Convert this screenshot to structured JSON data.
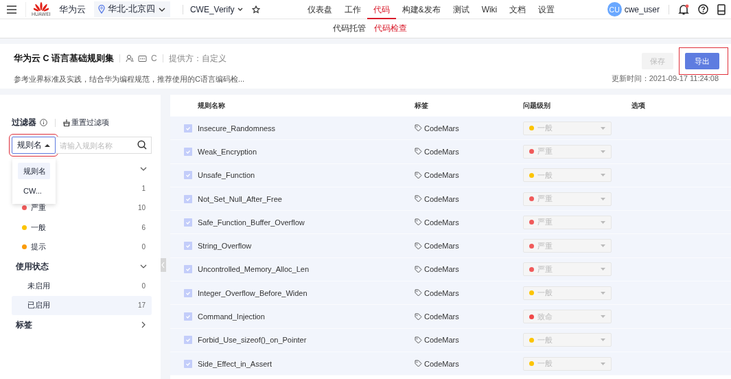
{
  "topbar": {
    "logo_text": "HUAWEI",
    "brand": "华为云",
    "region": "华北-北京四",
    "project": "CWE_Verify",
    "nav": [
      {
        "label": "仪表盘",
        "selected": false
      },
      {
        "label": "工作",
        "selected": false
      },
      {
        "label": "代码",
        "selected": true
      },
      {
        "label": "构建&发布",
        "selected": false
      },
      {
        "label": "测试",
        "selected": false
      },
      {
        "label": "Wiki",
        "selected": false
      },
      {
        "label": "文档",
        "selected": false
      },
      {
        "label": "设置",
        "selected": false
      }
    ],
    "avatar": "CU",
    "user": "cwe_user",
    "notification_dot": true
  },
  "subnav": [
    {
      "label": "代码托管",
      "selected": false
    },
    {
      "label": "代码检查",
      "selected": true
    }
  ],
  "ruleset": {
    "title": "华为云 C 语言基础规则集",
    "language": "C",
    "provider": "提供方：自定义",
    "description": "参考业界标准及实践，结合华为编程规范，推荐使用的C语言编码检...",
    "updated": "更新时间：2021-09-17 11:24:08",
    "buttons": [
      {
        "label": "保存",
        "kind": "secondary",
        "disabled": true,
        "highlighted": false
      },
      {
        "label": "导出",
        "kind": "primary",
        "disabled": false,
        "highlighted": true
      }
    ]
  },
  "filter": {
    "title": "过滤器",
    "reset": "重置过滤项",
    "field_type": "规则名",
    "placeholder": "请输入规则名称",
    "dropdown_highlighted": true,
    "dropdown": [
      {
        "label": "规则名",
        "selected": true
      },
      {
        "label": "CW..."
      }
    ],
    "groups": [
      {
        "expanded": true,
        "items": [
          {
            "count": "1"
          },
          {
            "label": "严重",
            "color": "#f05a5a",
            "count": "10",
            "selected": false
          },
          {
            "label": "一般",
            "color": "#fcc400",
            "count": "6",
            "selected": false
          },
          {
            "label": "提示",
            "color": "#fa9b0a",
            "count": "0",
            "selected": false
          }
        ]
      },
      {
        "title": "使用状态",
        "expanded": true,
        "items": [
          {
            "label": "未启用",
            "count": "0",
            "selected": false
          },
          {
            "label": "已启用",
            "count": "17",
            "selected": true
          }
        ]
      },
      {
        "title": "标签",
        "expanded": false
      }
    ]
  },
  "table": {
    "columns": [
      "规则名称",
      "标签",
      "问题级别",
      "选项"
    ],
    "rows": [
      {
        "checked": true,
        "name": "Insecure_Randomness",
        "tag": "CodeMars",
        "level": "一般",
        "color": "#fcc400"
      },
      {
        "checked": true,
        "name": "Weak_Encryption",
        "tag": "CodeMars",
        "level": "严重",
        "color": "#f05a5a"
      },
      {
        "checked": true,
        "name": "Unsafe_Function",
        "tag": "CodeMars",
        "level": "一般",
        "color": "#fcc400"
      },
      {
        "checked": true,
        "name": "Not_Set_Null_After_Free",
        "tag": "CodeMars",
        "level": "严重",
        "color": "#f05a5a"
      },
      {
        "checked": true,
        "name": "Safe_Function_Buffer_Overflow",
        "tag": "CodeMars",
        "level": "严重",
        "color": "#f05a5a"
      },
      {
        "checked": true,
        "name": "String_Overflow",
        "tag": "CodeMars",
        "level": "严重",
        "color": "#f05a5a"
      },
      {
        "checked": true,
        "name": "Uncontrolled_Memory_Alloc_Len",
        "tag": "CodeMars",
        "level": "严重",
        "color": "#f05a5a"
      },
      {
        "checked": true,
        "name": "Integer_Overflow_Before_Widen",
        "tag": "CodeMars",
        "level": "一般",
        "color": "#fcc400"
      },
      {
        "checked": true,
        "name": "Command_Injection",
        "tag": "CodeMars",
        "level": "致命",
        "color": "#f04848"
      },
      {
        "checked": true,
        "name": "Forbid_Use_sizeof()_on_Pointer",
        "tag": "CodeMars",
        "level": "一般",
        "color": "#fcc400"
      },
      {
        "checked": true,
        "name": "Side_Effect_in_Assert",
        "tag": "CodeMars",
        "level": "一般",
        "color": "#fcc400"
      }
    ]
  }
}
